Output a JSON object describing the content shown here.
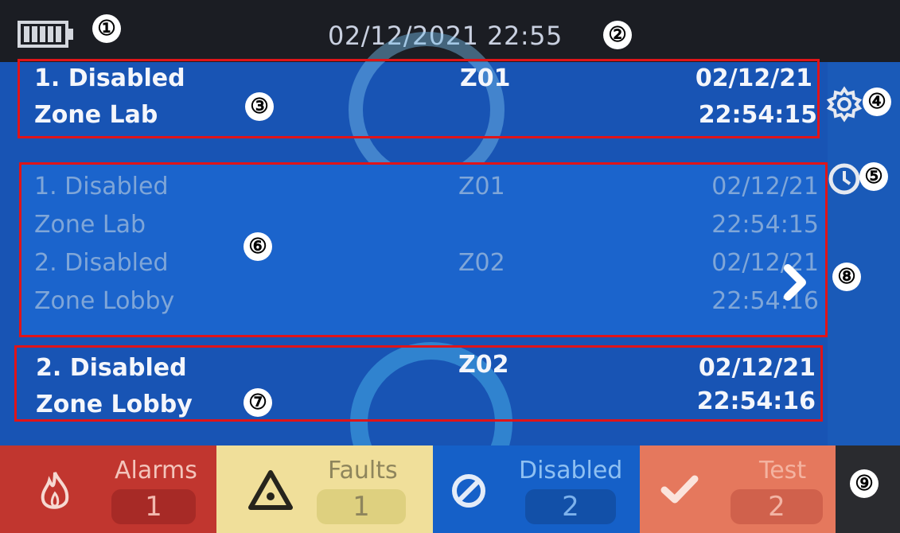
{
  "status": {
    "battery_icon": "battery-full-icon",
    "datetime": "02/12/2021 22:55"
  },
  "callouts": [
    "①",
    "②",
    "③",
    "④",
    "⑤",
    "⑥",
    "⑦",
    "⑧",
    "⑨"
  ],
  "current_event_top": {
    "title": "1. Disabled",
    "location": "Zone Lab",
    "zone": "Z01",
    "date": "02/12/21",
    "time": "22:54:15"
  },
  "event_list": [
    {
      "title": "1. Disabled",
      "location": "Zone Lab",
      "zone": "Z01",
      "date": "02/12/21",
      "time": "22:54:15"
    },
    {
      "title": "2. Disabled",
      "location": "Zone Lobby",
      "zone": "Z02",
      "date": "02/12/21",
      "time": "22:54:16"
    }
  ],
  "current_event_bottom": {
    "title": "2. Disabled",
    "location": "Zone Lobby",
    "zone": "Z02",
    "date": "02/12/21",
    "time": "22:54:16"
  },
  "side_buttons": {
    "settings_icon": "gear-icon",
    "history_icon": "clock-icon",
    "next_icon": "chevron-right-icon"
  },
  "tabs": [
    {
      "label": "Alarms",
      "count": "1",
      "icon": "flame-icon",
      "color": "#c1362f"
    },
    {
      "label": "Faults",
      "count": "1",
      "icon": "warning-icon",
      "color": "#f0df9a"
    },
    {
      "label": "Disabled",
      "count": "2",
      "icon": "disabled-icon",
      "color": "#1560c8"
    },
    {
      "label": "Test",
      "count": "2",
      "icon": "check-icon",
      "color": "#e5785d"
    }
  ]
}
